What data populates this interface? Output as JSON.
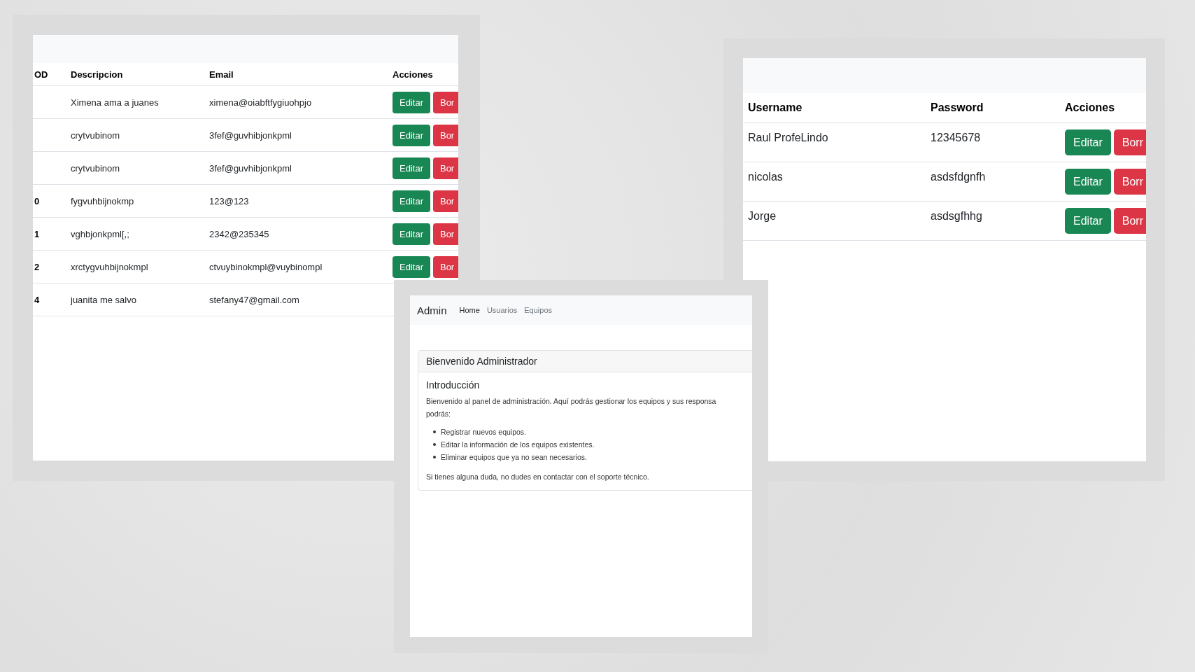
{
  "codes_window": {
    "columns": [
      "OD",
      "Descripcion",
      "Email",
      "Acciones"
    ],
    "rows": [
      {
        "code": "",
        "description": "Ximena ama a juanes",
        "email": "ximena@oiabftfygiuohpjo",
        "actions": [
          "Editar",
          "Bor"
        ]
      },
      {
        "code": "",
        "description": "crytvubinom",
        "email": "3fef@guvhibjonkpml",
        "actions": [
          "Editar",
          "Bor"
        ]
      },
      {
        "code": "",
        "description": "crytvubinom",
        "email": "3fef@guvhibjonkpml",
        "actions": [
          "Editar",
          "Bor"
        ]
      },
      {
        "code": "0",
        "description": "fygvuhbijnokmp",
        "email": "123@123",
        "actions": [
          "Editar",
          "Bor"
        ]
      },
      {
        "code": "1",
        "description": "vghbjonkpml[,;",
        "email": "2342@235345",
        "actions": [
          "Editar",
          "Bor"
        ]
      },
      {
        "code": "2",
        "description": "xrctygvuhbijnokmpl",
        "email": "ctvuybinokmpl@vuybinompl",
        "actions": [
          "Editar",
          "Bor"
        ]
      },
      {
        "code": "4",
        "description": "juanita me salvo",
        "email": "stefany47@gmail.com",
        "actions": []
      }
    ]
  },
  "admin_window": {
    "brand": "Admin",
    "nav": [
      {
        "label": "Home",
        "selected": true
      },
      {
        "label": "Usuarios",
        "selected": false
      },
      {
        "label": "Equipos",
        "selected": false
      }
    ],
    "card_title": "Bienvenido Administrador",
    "heading": "Introducción",
    "intro_lines": [
      "Bienvenido al panel de administración. Aquí podrás gestionar los equipos y sus responsa",
      "podrás:"
    ],
    "list": [
      "Registrar nuevos equipos.",
      "Editar la información de los equipos existentes.",
      "Eliminar equipos que ya no sean necesarios."
    ],
    "footer": "Si tienes alguna duda, no dudes en contactar con el soporte técnico."
  },
  "users_window": {
    "columns": [
      "Username",
      "Password",
      "Acciones"
    ],
    "rows": [
      {
        "username": "Raul ProfeLindo",
        "password": "12345678",
        "actions": [
          "Editar",
          "Borr"
        ]
      },
      {
        "username": "nicolas",
        "password": "asdsfdgnfh",
        "actions": [
          "Editar",
          "Borr"
        ]
      },
      {
        "username": "Jorge",
        "password": "asdsgfhhg",
        "actions": [
          "Editar",
          "Borr"
        ]
      }
    ]
  }
}
